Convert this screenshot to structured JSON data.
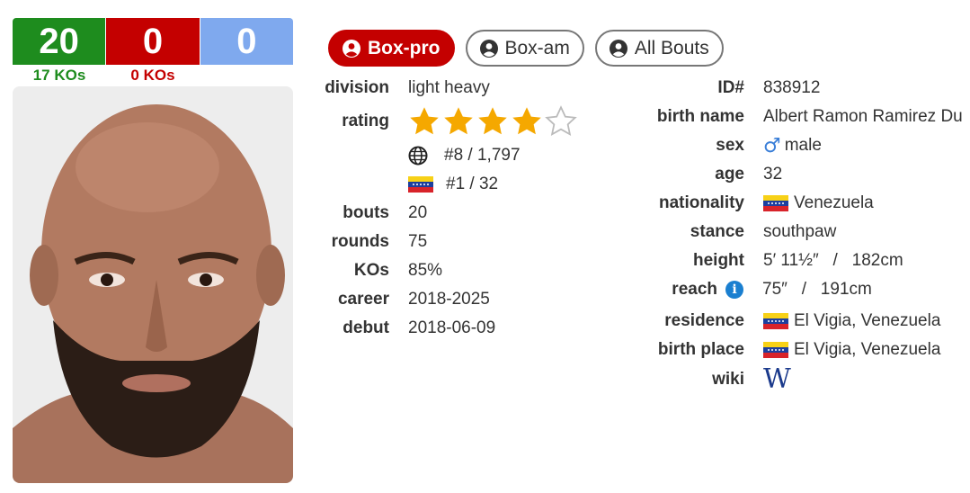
{
  "record": {
    "wins": "20",
    "losses": "0",
    "draws": "0",
    "win_kos": "17 KOs",
    "loss_kos": "0 KOs"
  },
  "tabs": {
    "box_pro": "Box-pro",
    "box_am": "Box-am",
    "all_bouts": "All Bouts"
  },
  "left": {
    "division_label": "division",
    "division": "light heavy",
    "rating_label": "rating",
    "rating_stars": 4,
    "rating_max": 5,
    "world_rank": "#8 / 1,797",
    "country_rank": "#1 / 32",
    "bouts_label": "bouts",
    "bouts": "20",
    "rounds_label": "rounds",
    "rounds": "75",
    "kos_label": "KOs",
    "kos": "85%",
    "career_label": "career",
    "career": "2018-2025",
    "debut_label": "debut",
    "debut": "2018-06-09"
  },
  "right": {
    "id_label": "ID#",
    "id": "838912",
    "birth_name_label": "birth name",
    "birth_name": "Albert Ramon Ramirez Du",
    "sex_label": "sex",
    "sex": "male",
    "age_label": "age",
    "age": "32",
    "nationality_label": "nationality",
    "nationality": "Venezuela",
    "stance_label": "stance",
    "stance": "southpaw",
    "height_label": "height",
    "height": "5′ 11½″   /   182cm",
    "reach_label": "reach",
    "reach": "75″   /   191cm",
    "residence_label": "residence",
    "residence": "El Vigia, Venezuela",
    "birth_place_label": "birth place",
    "birth_place": "El Vigia, Venezuela",
    "wiki_label": "wiki",
    "wiki_glyph": "W"
  },
  "colors": {
    "win": "#1e8c1e",
    "loss": "#c40000",
    "draw": "#7fa9ee",
    "star": "#f5a800"
  },
  "icons": {
    "tabs": "user-circle-icon",
    "world": "globe-icon",
    "reach_info": "info-icon",
    "wiki": "wikipedia-icon",
    "sex": "male-symbol-icon"
  }
}
